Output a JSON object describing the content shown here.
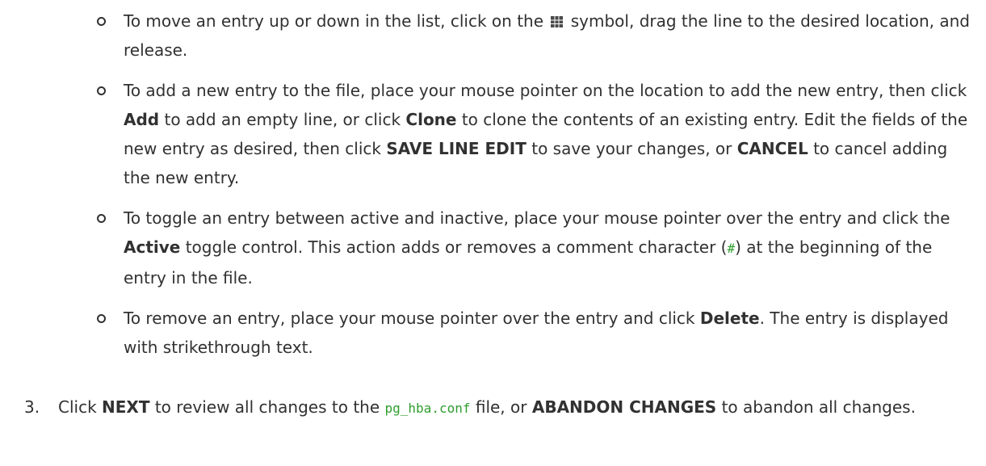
{
  "items": [
    {
      "t1": "To move an entry up or down in the list, click on the",
      "t2": "symbol, drag the line to the desired location, and release."
    },
    {
      "t1": "To add a new entry to the file, place your mouse pointer on the location to add the new entry, then click",
      "b1": "Add",
      "t2": "to add an empty line, or click",
      "b2": "Clone",
      "t3": "to clone the contents of an existing entry. Edit the fields of the new entry as desired, then click",
      "b3": "SAVE LINE EDIT",
      "t4": "to save your changes, or",
      "b4": "CANCEL",
      "t5": "to cancel adding the new entry."
    },
    {
      "t1": "To toggle an entry between active and inactive, place your mouse pointer over the entry and click the",
      "b1": "Active",
      "t2": "toggle control. This action adds or removes a comment character (",
      "c1": "#",
      "t3": ") at the beginning of the entry in the file."
    },
    {
      "t1": "To remove an entry, place your mouse pointer over the entry and click",
      "b1": "Delete",
      "t2": ". The entry is displayed with strikethrough text."
    }
  ],
  "step3": {
    "number": "3.",
    "t1": "Click",
    "b1": "NEXT",
    "t2": "to review all changes to the",
    "c1": "pg_hba.conf",
    "t3": "file, or",
    "b2": "ABANDON CHANGES",
    "t4": "to abandon all changes."
  },
  "icons": {
    "drag_handle": "grid-drag-icon"
  }
}
